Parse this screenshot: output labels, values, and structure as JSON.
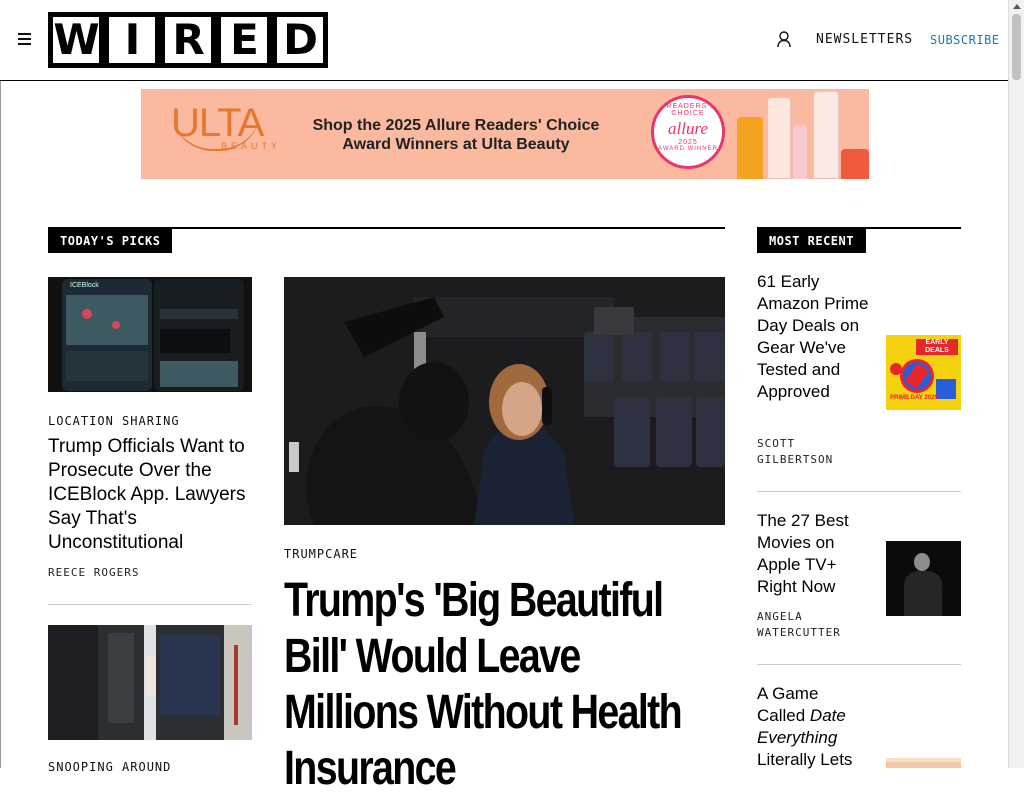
{
  "header": {
    "logo_letters": [
      "W",
      "I",
      "R",
      "E",
      "D"
    ],
    "newsletters": "NEWSLETTERS",
    "subscribe": "SUBSCRIBE"
  },
  "ad": {
    "brand": "ULTA",
    "brand_sub": "BEAUTY",
    "line1": "Shop the 2025 Allure Readers' Choice",
    "line2": "Award Winners at Ulta Beauty",
    "badge_top": "READERS' CHOICE",
    "badge_name": "allure",
    "badge_year": "2025",
    "badge_bottom": "AWARD WINNER"
  },
  "todays_picks": {
    "label": "TODAY'S PICKS",
    "stories": [
      {
        "rubric": "LOCATION SHARING",
        "headline": "Trump Officials Want to Prosecute Over the ICEBlock App. Lawyers Say That's Unconstitutional",
        "byline": "REECE ROGERS",
        "thumb_label": "ICEBlock"
      },
      {
        "rubric": "SNOOPING AROUND"
      }
    ],
    "feature": {
      "rubric": "TRUMPCARE",
      "headline": "Trump's 'Big Beautiful Bill' Would Leave Millions Without Health Insurance"
    }
  },
  "most_recent": {
    "label": "MOST RECENT",
    "items": [
      {
        "headline": "61 Early Amazon Prime Day Deals on Gear We've Tested and Approved",
        "byline_line1": "SCOTT",
        "byline_line2": "GILBERTSON",
        "thumb_text_top": "EARLY DEALS",
        "thumb_text_bottom": "PRIME DAY 2025"
      },
      {
        "headline": "The 27 Best Movies on Apple TV+ Right Now",
        "byline_line1": "ANGELA",
        "byline_line2": "WATERCUTTER"
      },
      {
        "headline_parts": [
          "A Game Called ",
          "Date Everything",
          " Literally Lets"
        ]
      }
    ]
  },
  "colors": {
    "accent_subscribe": "#1a7aaa",
    "ad_background": "#fbb9a0",
    "ulta_orange": "#e8772e",
    "allure_pink": "#e8376a"
  },
  "icons": [
    "hamburger-menu-icon",
    "user-icon",
    "scroll-up-arrow-icon"
  ]
}
